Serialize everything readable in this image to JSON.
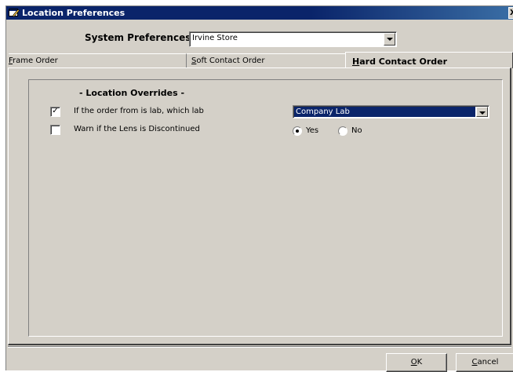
{
  "window": {
    "title": "Location Preferences",
    "close_glyph": "X"
  },
  "system_prefs": {
    "label": "System Preferences for",
    "store_value": "Irvine Store"
  },
  "tabs": [
    {
      "mnemonic": "F",
      "rest": "rame Order",
      "active": false
    },
    {
      "mnemonic": "S",
      "rest": "oft Contact Order",
      "active": false
    },
    {
      "mnemonic": "H",
      "rest": "ard Contact Order",
      "active": true
    }
  ],
  "overrides": {
    "title": "- Location Overrides -",
    "rows": [
      {
        "label": "If the order from is lab, which lab",
        "checked": true,
        "check_glyph": "✓"
      },
      {
        "label": "Warn if the Lens is Discontinued",
        "checked": false,
        "check_glyph": ""
      }
    ],
    "lab_value": "Company Lab",
    "radio": {
      "yes_label": "Yes",
      "no_label": "No",
      "selected": "Yes"
    }
  },
  "buttons": {
    "ok": {
      "mnemonic": "O",
      "rest": "K"
    },
    "cancel": {
      "mnemonic": "C",
      "rest": "ancel"
    }
  },
  "icons": {
    "app": "window-edit-icon",
    "dropdown": "chevron-down-icon"
  },
  "colors": {
    "title_bar": "#0a246a",
    "face": "#d4d0c8",
    "selection": "#0a246a"
  }
}
